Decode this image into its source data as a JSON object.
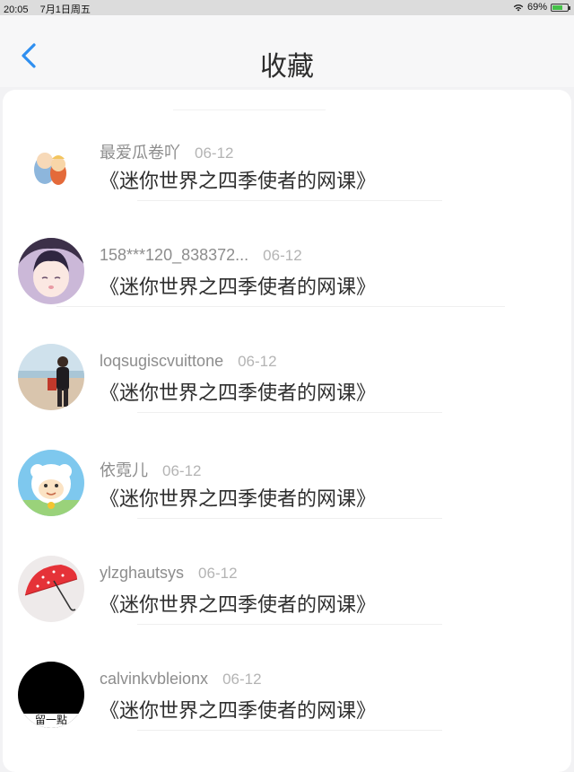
{
  "status": {
    "time": "20:05",
    "date": "7月1日周五",
    "battery": "69%",
    "battery_level": 0.69,
    "wifi_icon": "wifi-icon",
    "battery_icon": "battery-icon"
  },
  "header": {
    "title": "收藏",
    "back_icon": "chevron-left-icon",
    "accent": "#2f8ff0"
  },
  "items": [
    {
      "username": "最爱瓜卷吖",
      "date": "06-12",
      "title": "《迷你世界之四季使者的网课》",
      "avatar": "cartoon-kids-avatar"
    },
    {
      "username": "158***120_838372...",
      "date": "06-12",
      "title": "《迷你世界之四季使者的网课》",
      "avatar": "anime-girl-avatar"
    },
    {
      "username": "loqsugiscvuittone",
      "date": "06-12",
      "title": "《迷你世界之四季使者的网课》",
      "avatar": "beach-photo-avatar"
    },
    {
      "username": "依霓儿",
      "date": "06-12",
      "title": "《迷你世界之四季使者的网课》",
      "avatar": "sheep-cartoon-avatar"
    },
    {
      "username": "ylzghautsys",
      "date": "06-12",
      "title": "《迷你世界之四季使者的网课》",
      "avatar": "umbrella-avatar"
    },
    {
      "username": "calvinkvbleionx",
      "date": "06-12",
      "title": "《迷你世界之四季使者的网课》",
      "avatar": "black-text-avatar",
      "avatar_text": "留一點"
    }
  ]
}
